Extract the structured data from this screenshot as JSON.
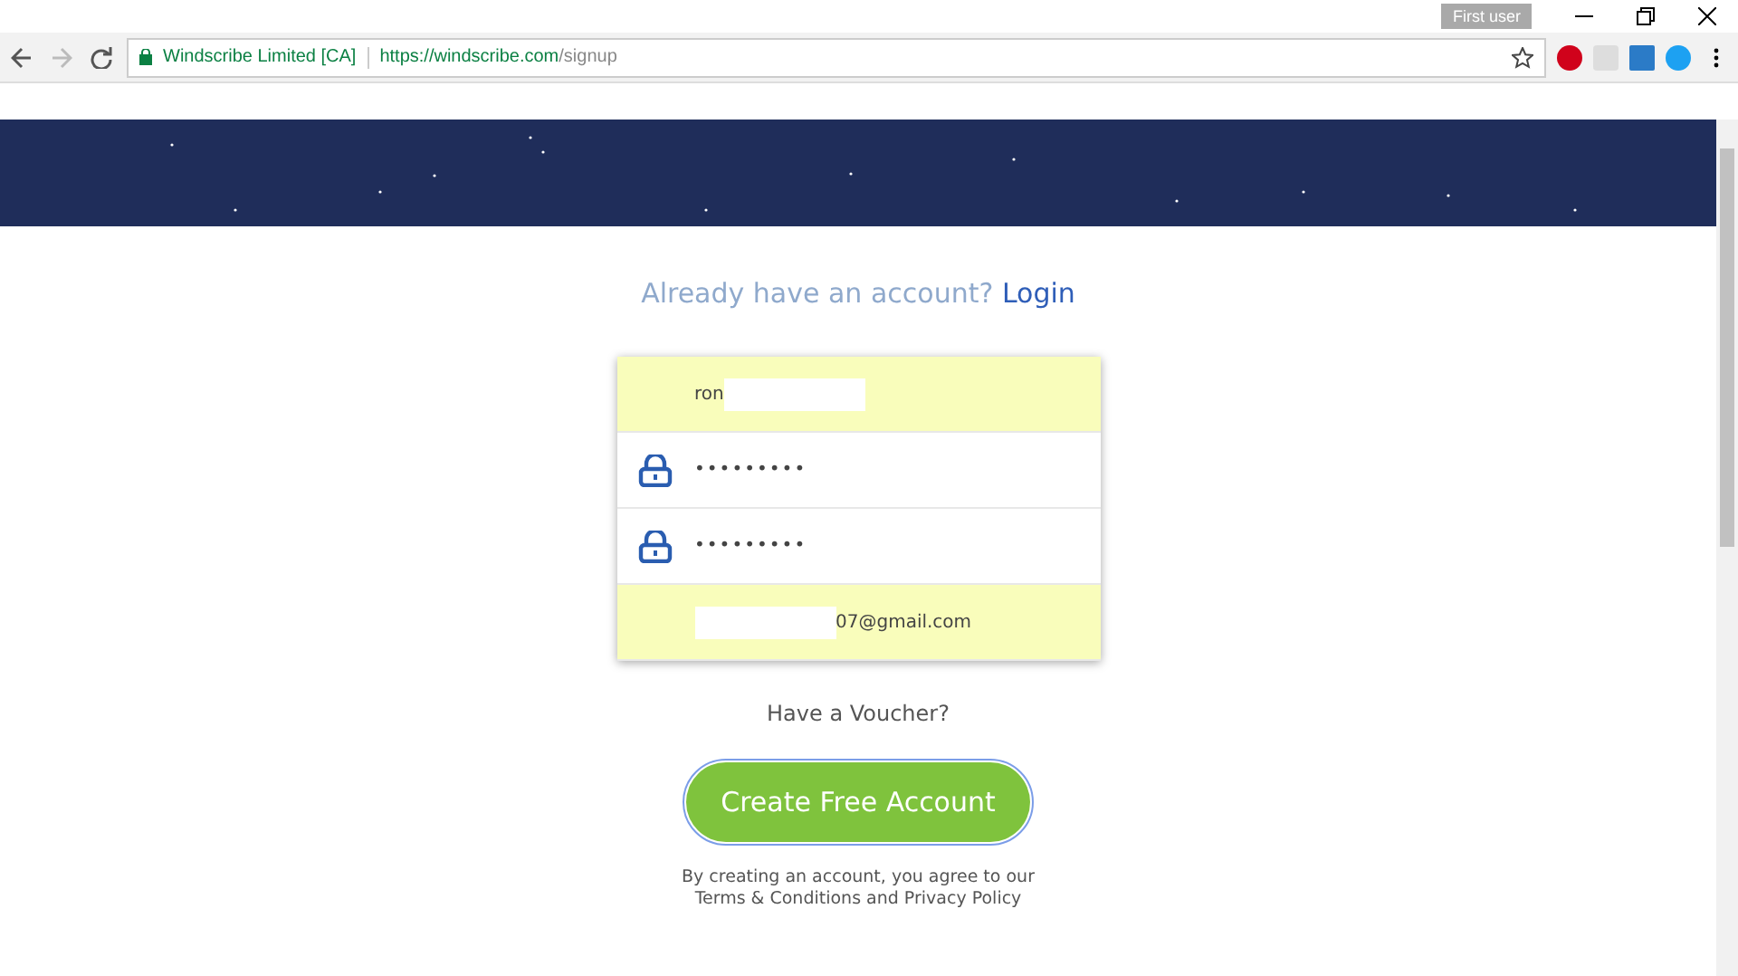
{
  "browser": {
    "profile": "First user",
    "site_identity": "Windscribe Limited [CA]",
    "url_host": "https://windscribe.com",
    "url_path": "/signup",
    "bookmarked": false
  },
  "login_prompt": {
    "text": "Already have an account?",
    "link": "Login"
  },
  "fields": [
    {
      "kind": "text",
      "value": "ron",
      "autofilled": true,
      "masked_after": true
    },
    {
      "kind": "password",
      "value": "•••••••••",
      "autofilled": false
    },
    {
      "kind": "password",
      "value": "•••••••••",
      "autofilled": false
    },
    {
      "kind": "text",
      "value": "07@gmail.com",
      "autofilled": true,
      "masked_before": true
    }
  ],
  "voucher_link": "Have a Voucher?",
  "submit": {
    "label": "Create Free Account",
    "focused": true
  },
  "terms": "By creating an account, you agree to our Terms & Conditions and Privacy Policy"
}
